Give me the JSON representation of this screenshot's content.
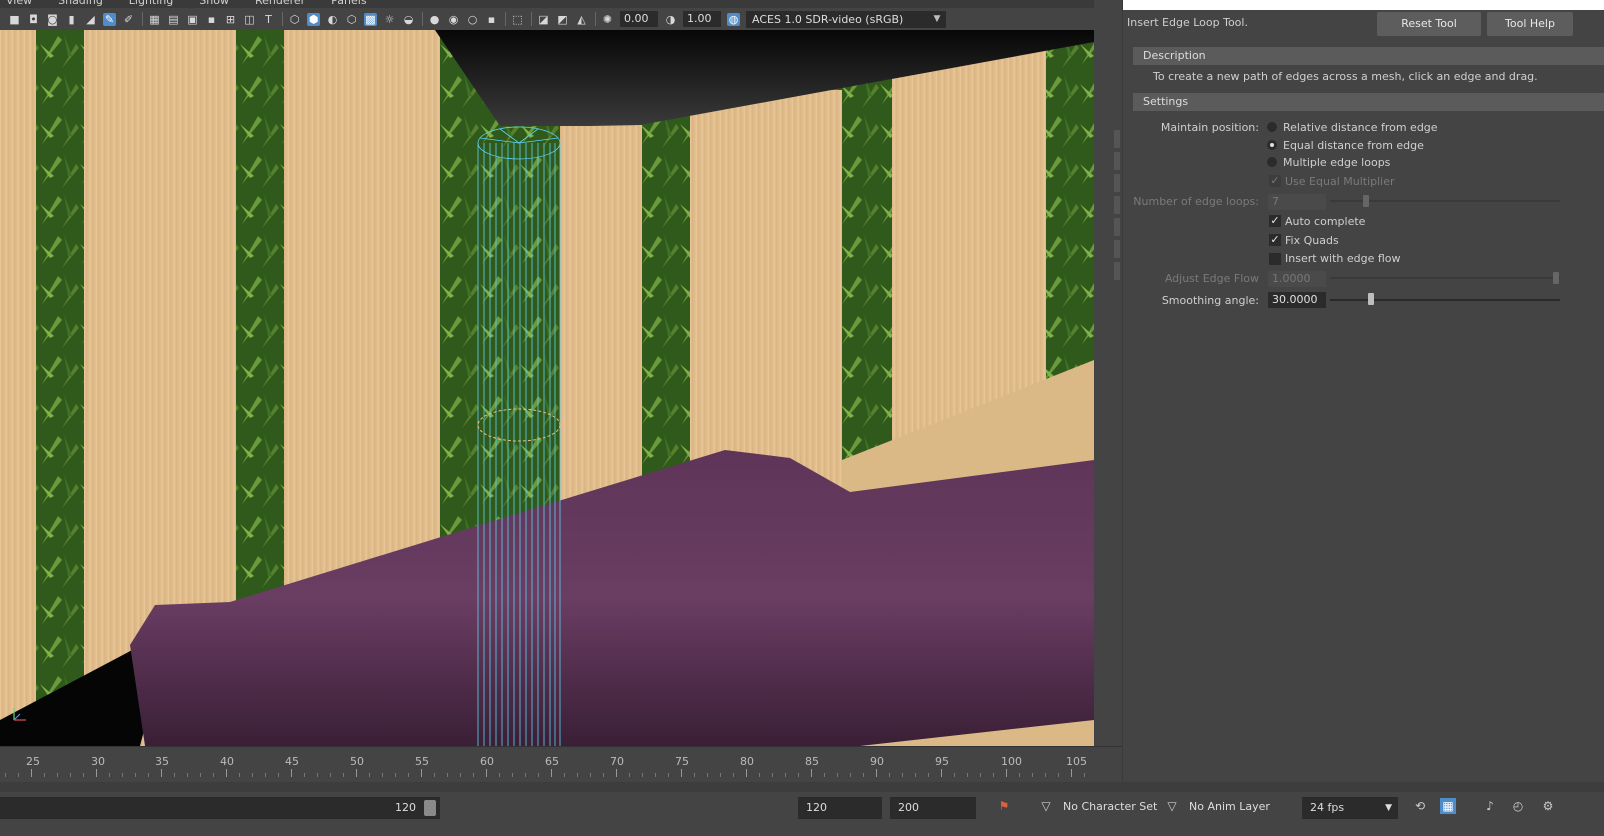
{
  "menubar": {
    "items": [
      "View",
      "Shading",
      "Lighting",
      "Show",
      "Renderer",
      "Panels"
    ]
  },
  "toolbar": {
    "camera_value": "0.00",
    "gamma_value": "1.00",
    "color_space": "ACES 1.0 SDR-video (sRGB)",
    "icons": [
      "camera-icon",
      "camera-attributes-icon",
      "bookmark-icon",
      "image-plane-icon",
      "grid-toggle-icon",
      "film-gate-icon",
      "resolution-gate-icon",
      "gate-mask-icon",
      "field-chart-icon",
      "safe-action-icon",
      "safe-title-icon",
      "wireframe-icon",
      "smooth-shade-icon",
      "default-material-icon",
      "wireframe-on-shaded-icon",
      "textured-icon",
      "use-all-lights-icon",
      "shadows-icon",
      "screen-space-ao-icon",
      "motion-blur-icon",
      "anti-aliasing-icon",
      "depth-of-field-icon",
      "isolate-select-icon",
      "xray-icon",
      "xray-joints-icon",
      "backface-culling-icon",
      "exposure-icon",
      "gamma-icon",
      "color-management-icon"
    ]
  },
  "tool_panel": {
    "title": "Insert Edge Loop Tool.",
    "reset_button": "Reset Tool",
    "help_button": "Tool Help",
    "description_header": "Description",
    "description_text": "To create a new path of edges across a mesh, click an edge and drag.",
    "settings_header": "Settings",
    "maintain_position_label": "Maintain position:",
    "maintain_options": [
      {
        "label": "Relative distance from edge",
        "selected": false
      },
      {
        "label": "Equal distance from edge",
        "selected": true
      },
      {
        "label": "Multiple edge loops",
        "selected": false
      }
    ],
    "use_equal_multiplier": {
      "label": "Use Equal Multiplier",
      "checked": true,
      "enabled": false
    },
    "number_of_edge_loops": {
      "label": "Number of edge loops:",
      "value": "7",
      "enabled": false
    },
    "auto_complete": {
      "label": "Auto complete",
      "checked": true
    },
    "fix_quads": {
      "label": "Fix Quads",
      "checked": true
    },
    "insert_with_edge_flow": {
      "label": "Insert with edge flow",
      "checked": false
    },
    "adjust_edge_flow": {
      "label": "Adjust Edge Flow",
      "value": "1.0000",
      "enabled": false
    },
    "smoothing_angle": {
      "label": "Smoothing angle:",
      "value": "30.0000"
    }
  },
  "timeline": {
    "labels": [
      "25",
      "30",
      "35",
      "40",
      "45",
      "50",
      "55",
      "60",
      "65",
      "70",
      "75",
      "80",
      "85",
      "90",
      "95",
      "100",
      "105"
    ]
  },
  "statusbar": {
    "range_end_inner": "120",
    "playback_end": "120",
    "animation_end": "200",
    "character_set": "No Character Set",
    "anim_layer": "No Anim Layer",
    "fps": "24 fps"
  },
  "colors": {
    "wireframe": "#5fd3f0",
    "sofa": "#5e3558",
    "wood": "#e3c18e",
    "foliage": "#3e6b23",
    "keyframe_marker": "#e0603a"
  }
}
